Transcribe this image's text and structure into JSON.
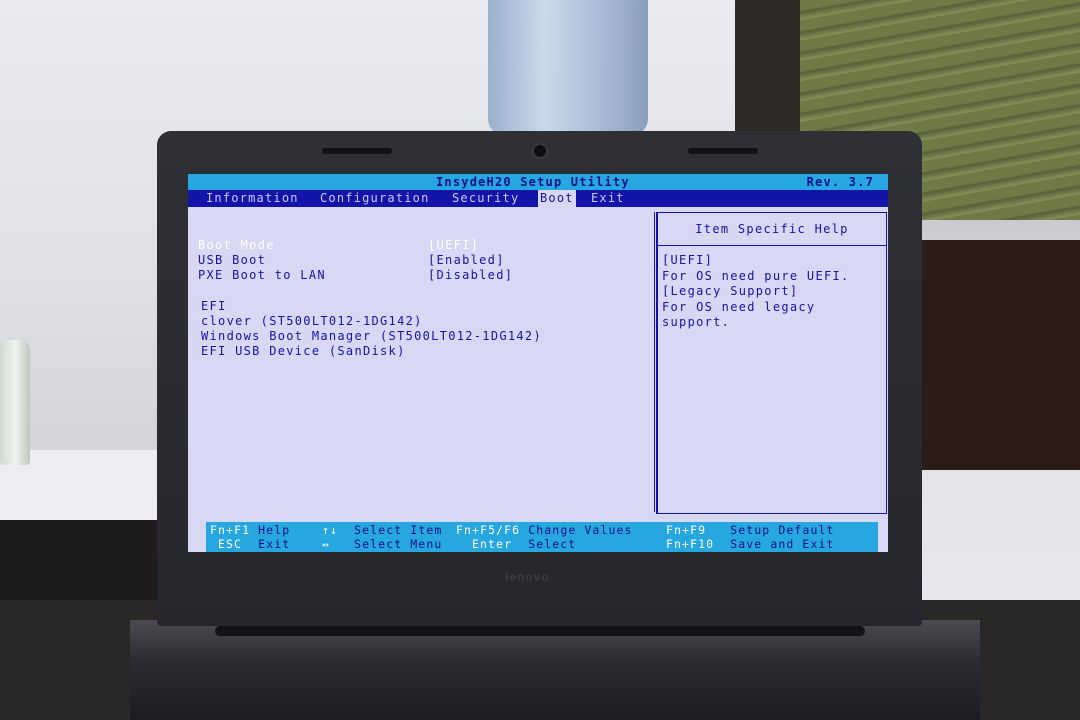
{
  "bios": {
    "title": "InsydeH20 Setup Utility",
    "revision": "Rev. 3.7",
    "menu": [
      {
        "label": "Information"
      },
      {
        "label": "Configuration"
      },
      {
        "label": "Security"
      },
      {
        "label": "Boot"
      },
      {
        "label": "Exit"
      }
    ],
    "active_menu": "Boot",
    "settings": [
      {
        "label": "Boot Mode",
        "value": "[UEFI]",
        "selected": true
      },
      {
        "label": "USB Boot",
        "value": "[Enabled]",
        "selected": false
      },
      {
        "label": "PXE Boot to LAN",
        "value": "[Disabled]",
        "selected": false
      }
    ],
    "efi_header": "EFI",
    "efi_entries": [
      "clover (ST500LT012-1DG142)",
      "Windows Boot Manager (ST500LT012-1DG142)",
      "EFI USB Device (SanDisk)"
    ],
    "help": {
      "title": "Item Specific Help",
      "lines": [
        "[UEFI]",
        "For OS need pure UEFI.",
        "[Legacy Support]",
        "For OS need legacy",
        "support."
      ]
    },
    "footer": {
      "f1_key": "Fn+F1",
      "f1_label": "Help",
      "esc_key": "ESC",
      "esc_label": "Exit",
      "updown_key": "↑↓",
      "updown_label": "Select Item",
      "leftright_key": "↔",
      "leftright_label": "Select Menu",
      "f5f6_key": "Fn+F5/F6",
      "f5f6_label": "Change Values",
      "enter_key": "Enter",
      "enter_label": "Select",
      "f9_key": "Fn+F9",
      "f9_label": "Setup Default",
      "f10_key": "Fn+F10",
      "f10_label": "Save and Exit"
    }
  },
  "laptop": {
    "brand": "lenovo"
  },
  "colors": {
    "screen_bg": "#d8d8f4",
    "title_bar": "#27a7e0",
    "menu_bar": "#1414a8",
    "text": "#1414a8",
    "highlight_text": "#ffffff"
  }
}
